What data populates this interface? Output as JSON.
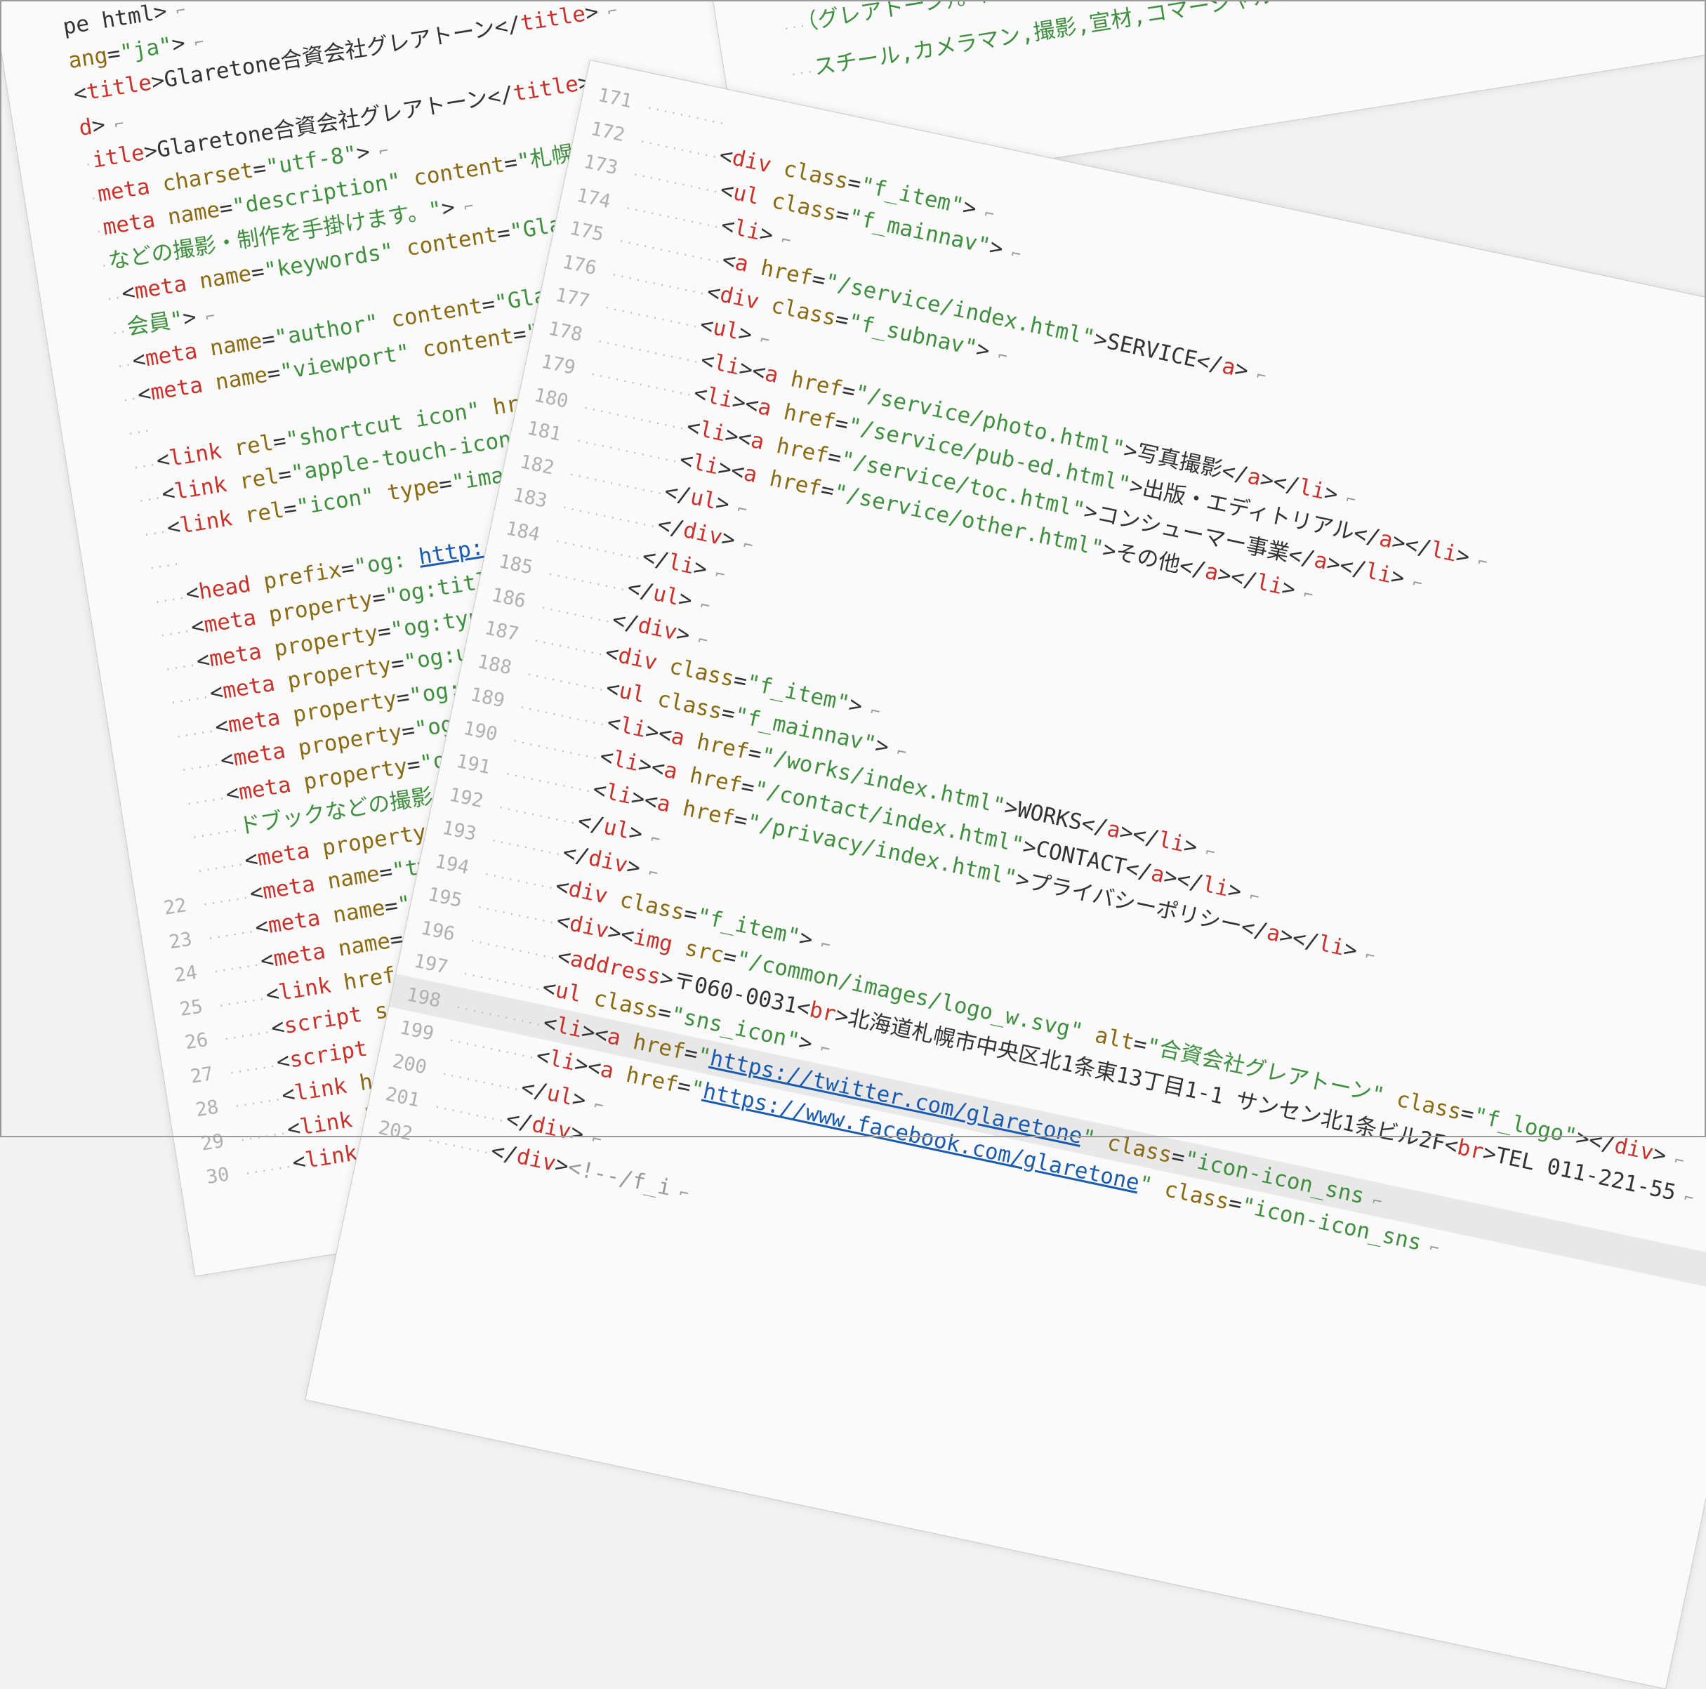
{
  "back_sheet": {
    "lines": [
      {
        "n": "",
        "html": "<span class='p'>pe html&gt;</span>"
      },
      {
        "n": "",
        "html": "<span class='a'>ang</span><span class='p'>=</span><span class='s'>\"ja\"</span><span class='p'>&gt;</span>"
      },
      {
        "n": "",
        "html": "<span class='p'>&lt;</span><span class='t'>title</span><span class='p'>&gt;Glaretone合資会社グレアトーン&lt;/</span><span class='t'>title</span><span class='p'>&gt;</span>"
      },
      {
        "n": "",
        "html": "<span class='t'>d</span><span class='p'>&gt;</span>"
      },
      {
        "n": "",
        "html": "<span class='t'>itle</span><span class='p'>&gt;Glaretone合資会社グレアトーン&lt;/</span><span class='t'>title</span><span class='p'>&gt;</span>"
      },
      {
        "n": "",
        "html": "<span class='t'>meta</span> <span class='a'>charset</span><span class='p'>=</span><span class='s'>\"utf-8\"</span><span class='p'>&gt;</span>"
      },
      {
        "n": "",
        "html": "<span class='t'>meta</span> <span class='a'>name</span><span class='p'>=</span><span class='s'>\"description\"</span> <span class='a'>content</span><span class='p'>=</span><span class='s'>\"札幌のフォトスタジオ</span>"
      },
      {
        "n": "",
        "html": "<span class='s'>などの撮影・制作を手掛けます。\"</span><span class='p'>&gt;</span>"
      },
      {
        "n": "",
        "html": "<span class='p'>&lt;</span><span class='t'>meta</span> <span class='a'>name</span><span class='p'>=</span><span class='s'>\"keywords\"</span> <span class='a'>content</span><span class='p'>=</span><span class='s'>\"Glaretone,グレアトーン</span>"
      },
      {
        "n": "",
        "html": "<span class='s'>会員\"</span><span class='p'>&gt;</span>"
      },
      {
        "n": "",
        "html": "<span class='p'>&lt;</span><span class='t'>meta</span> <span class='a'>name</span><span class='p'>=</span><span class='s'>\"author\"</span> <span class='a'>content</span><span class='p'>=</span><span class='s'>\"Glaretone\"</span><span class='p'>&gt;</span>"
      },
      {
        "n": "",
        "html": "<span class='p'>&lt;</span><span class='t'>meta</span> <span class='a'>name</span><span class='p'>=</span><span class='s'>\"viewport\"</span> <span class='a'>content</span><span class='p'>=</span><span class='s'>\"width=device-width</span>"
      },
      {
        "n": "",
        "html": ""
      },
      {
        "n": "",
        "html": "<span class='p'>&lt;</span><span class='t'>link</span> <span class='a'>rel</span><span class='p'>=</span><span class='s'>\"shortcut icon\"</span> <span class='a'>href</span><span class='p'>=</span><span class='s'>\"/favicon.ico\"</span><span class='p'>&gt;</span>"
      },
      {
        "n": "",
        "html": "<span class='p'>&lt;</span><span class='t'>link</span> <span class='a'>rel</span><span class='p'>=</span><span class='s'>\"apple-touch-icon\"</span> <span class='a'>href</span><span class='p'>=</span><span class='s'>\"/apple-tou</span>"
      },
      {
        "n": "",
        "html": "<span class='p'>&lt;</span><span class='t'>link</span> <span class='a'>rel</span><span class='p'>=</span><span class='s'>\"icon\"</span> <span class='a'>type</span><span class='p'>=</span><span class='s'>\"image/png\"</span> <span class='a'>href</span><span class='p'>=</span><span class='s'>\"/and</span>"
      },
      {
        "n": "",
        "html": ""
      },
      {
        "n": "",
        "html": "<span class='p'>&lt;</span><span class='t'>head</span> <span class='a'>prefix</span><span class='p'>=</span><span class='s'>\"og: </span><span class='u'>http://ogp.me/ns</span><span class='s'># fb: </span><span class='u'>h</span>"
      },
      {
        "n": "",
        "html": "<span class='p'>&lt;</span><span class='t'>meta</span> <span class='a'>property</span><span class='p'>=</span><span class='s'>\"og:title\"</span> <span class='a'>content</span><span class='p'>=</span><span class='s'>\"合資会</span>"
      },
      {
        "n": "",
        "html": "<span class='p'>&lt;</span><span class='t'>meta</span> <span class='a'>property</span><span class='p'>=</span><span class='s'>\"og:type\"</span> <span class='a'>content</span><span class='p'>=</span><span class='s'>\"websi</span>"
      },
      {
        "n": "",
        "html": "<span class='p'>&lt;</span><span class='t'>meta</span> <span class='a'>property</span><span class='p'>=</span><span class='s'>\"og:url\"</span> <span class='a'>content</span><span class='p'>=</span><span class='s'>\"</span><span class='u'>https</span>"
      },
      {
        "n": "",
        "html": "<span class='p'>&lt;</span><span class='t'>meta</span> <span class='a'>property</span><span class='p'>=</span><span class='s'>\"og:image\"</span> <span class='a'>content</span><span class='p'>=</span><span class='s'>\"</span><span class='u'>h</span>"
      },
      {
        "n": "",
        "html": "<span class='p'>&lt;</span><span class='t'>meta</span> <span class='a'>property</span><span class='p'>=</span><span class='s'>\"og:site_name\"</span> <span class='a'>conte</span>"
      },
      {
        "n": "",
        "html": "<span class='p'>&lt;</span><span class='t'>meta</span> <span class='a'>property</span><span class='p'>=</span><span class='s'>\"og:description\"</span> <span class='a'>co</span>"
      },
      {
        "n": "",
        "html": "<span class='s'>ドブックなどの撮影・制作を手掛け</span>"
      },
      {
        "n": "",
        "html": "<span class='p'>&lt;</span><span class='t'>meta</span> <span class='a'>property</span><span class='p'>=</span><span class='s'>\"og:locale\"</span> <span class='a'>conte</span>"
      },
      {
        "n": "22",
        "html": "<span class='p'>&lt;</span><span class='t'>meta</span> <span class='a'>name</span><span class='p'>=</span><span class='s'>\"twitter:card\"</span> <span class='a'>conte</span>"
      },
      {
        "n": "23",
        "html": "<span class='p'>&lt;</span><span class='t'>meta</span> <span class='a'>name</span><span class='p'>=</span><span class='s'>\"twitter:site\"</span> <span class='a'>con</span>"
      },
      {
        "n": "24",
        "html": "<span class='p'>&lt;</span><span class='t'>meta</span> <span class='a'>name</span><span class='p'>=</span><span class='s'>\"twitter:creator\"</span>"
      },
      {
        "n": "25",
        "html": "<span class='p'>&lt;</span><span class='t'>link</span> <span class='a'>href</span><span class='p'>=</span><span class='s'>\"/common/css/pac</span>"
      },
      {
        "n": "26",
        "html": "<span class='p'>&lt;</span><span class='t'>script</span> <span class='a'>src</span><span class='p'>=</span><span class='s'>\"/common/js/jq</span>"
      },
      {
        "n": "27",
        "html": "<span class='p'>&lt;</span><span class='t'>script</span> <span class='a'>src</span><span class='p'>=</span><span class='s'>\"/common/js/p</span>"
      },
      {
        "n": "28",
        "html": "<span class='p'>&lt;</span><span class='t'>link</span> <span class='a'>href</span><span class='p'>=</span><span class='s'>\"/common/css</span>"
      },
      {
        "n": "29",
        "html": "<span class='p'>&lt;</span><span class='t'>link</span> <span class='a'>href</span><span class='p'>=</span><span class='s'>\"/common/cs</span>"
      },
      {
        "n": "30",
        "html": "<span class='p'>&lt;</span><span class='t'>link</span> <span class='a'>href</span><span class='p'>=</span><span class='s'>\"/common/c</span>"
      }
    ]
  },
  "top_sheet": {
    "lines": [
      {
        "n": "",
        "html": "<span class='s'>（グレアトーン）。料理、スポーツ、人物(モデル)、キッチンスタジオ</span>"
      },
      {
        "n": "",
        "html": "<span class='s'>スチール,カメラマン,撮影,宣材,コマーシャルフォト,キッチンスタジオ</span>"
      }
    ]
  },
  "front_sheet": {
    "lines": [
      {
        "n": "171",
        "html": ""
      },
      {
        "n": "172",
        "html": "<span class='p'>&lt;</span><span class='t'>div</span> <span class='a'>class</span><span class='p'>=</span><span class='s'>\"f_item\"</span><span class='p'>&gt;</span>"
      },
      {
        "n": "173",
        "html": "<span class='p'>&lt;</span><span class='t'>ul</span> <span class='a'>class</span><span class='p'>=</span><span class='s'>\"f_mainnav\"</span><span class='p'>&gt;</span>"
      },
      {
        "n": "174",
        "html": "<span class='p'>&lt;</span><span class='t'>li</span><span class='p'>&gt;</span>"
      },
      {
        "n": "175",
        "html": "<span class='p'>&lt;</span><span class='t'>a</span> <span class='a'>href</span><span class='p'>=</span><span class='s'>\"/service/index.html\"</span><span class='p'>&gt;SERVICE&lt;/</span><span class='t'>a</span><span class='p'>&gt;</span>"
      },
      {
        "n": "176",
        "html": "<span class='p'>&lt;</span><span class='t'>div</span> <span class='a'>class</span><span class='p'>=</span><span class='s'>\"f_subnav\"</span><span class='p'>&gt;</span>"
      },
      {
        "n": "177",
        "html": "<span class='p'>&lt;</span><span class='t'>ul</span><span class='p'>&gt;</span>"
      },
      {
        "n": "178",
        "html": "<span class='p'>&lt;</span><span class='t'>li</span><span class='p'>&gt;&lt;</span><span class='t'>a</span> <span class='a'>href</span><span class='p'>=</span><span class='s'>\"/service/photo.html\"</span><span class='p'>&gt;写真撮影&lt;/</span><span class='t'>a</span><span class='p'>&gt;&lt;/</span><span class='t'>li</span><span class='p'>&gt;</span>"
      },
      {
        "n": "179",
        "html": "<span class='p'>&lt;</span><span class='t'>li</span><span class='p'>&gt;&lt;</span><span class='t'>a</span> <span class='a'>href</span><span class='p'>=</span><span class='s'>\"/service/pub-ed.html\"</span><span class='p'>&gt;出版・エディトリアル&lt;/</span><span class='t'>a</span><span class='p'>&gt;&lt;/</span><span class='t'>li</span><span class='p'>&gt;</span>"
      },
      {
        "n": "180",
        "html": "<span class='p'>&lt;</span><span class='t'>li</span><span class='p'>&gt;&lt;</span><span class='t'>a</span> <span class='a'>href</span><span class='p'>=</span><span class='s'>\"/service/toc.html\"</span><span class='p'>&gt;コンシューマー事業&lt;/</span><span class='t'>a</span><span class='p'>&gt;&lt;/</span><span class='t'>li</span><span class='p'>&gt;</span>"
      },
      {
        "n": "181",
        "html": "<span class='p'>&lt;</span><span class='t'>li</span><span class='p'>&gt;&lt;</span><span class='t'>a</span> <span class='a'>href</span><span class='p'>=</span><span class='s'>\"/service/other.html\"</span><span class='p'>&gt;その他&lt;/</span><span class='t'>a</span><span class='p'>&gt;&lt;/</span><span class='t'>li</span><span class='p'>&gt;</span>"
      },
      {
        "n": "182",
        "html": "<span class='p'>&lt;/</span><span class='t'>ul</span><span class='p'>&gt;</span>"
      },
      {
        "n": "183",
        "html": "<span class='p'>&lt;/</span><span class='t'>div</span><span class='p'>&gt;</span>"
      },
      {
        "n": "184",
        "html": "<span class='p'>&lt;/</span><span class='t'>li</span><span class='p'>&gt;</span>"
      },
      {
        "n": "185",
        "html": "<span class='p'>&lt;/</span><span class='t'>ul</span><span class='p'>&gt;</span>"
      },
      {
        "n": "186",
        "html": "<span class='p'>&lt;/</span><span class='t'>div</span><span class='p'>&gt;</span>"
      },
      {
        "n": "187",
        "html": "<span class='p'>&lt;</span><span class='t'>div</span> <span class='a'>class</span><span class='p'>=</span><span class='s'>\"f_item\"</span><span class='p'>&gt;</span>"
      },
      {
        "n": "188",
        "html": "<span class='p'>&lt;</span><span class='t'>ul</span> <span class='a'>class</span><span class='p'>=</span><span class='s'>\"f_mainnav\"</span><span class='p'>&gt;</span>"
      },
      {
        "n": "189",
        "html": "<span class='p'>&lt;</span><span class='t'>li</span><span class='p'>&gt;&lt;</span><span class='t'>a</span> <span class='a'>href</span><span class='p'>=</span><span class='s'>\"/works/index.html\"</span><span class='p'>&gt;WORKS&lt;/</span><span class='t'>a</span><span class='p'>&gt;&lt;/</span><span class='t'>li</span><span class='p'>&gt;</span>"
      },
      {
        "n": "190",
        "html": "<span class='p'>&lt;</span><span class='t'>li</span><span class='p'>&gt;&lt;</span><span class='t'>a</span> <span class='a'>href</span><span class='p'>=</span><span class='s'>\"/contact/index.html\"</span><span class='p'>&gt;CONTACT&lt;/</span><span class='t'>a</span><span class='p'>&gt;&lt;/</span><span class='t'>li</span><span class='p'>&gt;</span>"
      },
      {
        "n": "191",
        "html": "<span class='p'>&lt;</span><span class='t'>li</span><span class='p'>&gt;&lt;</span><span class='t'>a</span> <span class='a'>href</span><span class='p'>=</span><span class='s'>\"/privacy/index.html\"</span><span class='p'>&gt;プライバシーポリシー&lt;/</span><span class='t'>a</span><span class='p'>&gt;&lt;/</span><span class='t'>li</span><span class='p'>&gt;</span>"
      },
      {
        "n": "192",
        "html": "<span class='p'>&lt;/</span><span class='t'>ul</span><span class='p'>&gt;</span>"
      },
      {
        "n": "193",
        "html": "<span class='p'>&lt;/</span><span class='t'>div</span><span class='p'>&gt;</span>"
      },
      {
        "n": "194",
        "html": "<span class='p'>&lt;</span><span class='t'>div</span> <span class='a'>class</span><span class='p'>=</span><span class='s'>\"f_item\"</span><span class='p'>&gt;</span>"
      },
      {
        "n": "195",
        "html": "<span class='p'>&lt;</span><span class='t'>div</span><span class='p'>&gt;&lt;</span><span class='t'>img</span> <span class='a'>src</span><span class='p'>=</span><span class='s'>\"/common/images/logo_w.svg\"</span> <span class='a'>alt</span><span class='p'>=</span><span class='s'>\"合資会社グレアトーン\"</span> <span class='a'>class</span><span class='p'>=</span><span class='s'>\"f_logo\"</span><span class='p'>&gt;&lt;/</span><span class='t'>div</span><span class='p'>&gt;</span>"
      },
      {
        "n": "196",
        "html": "<span class='p'>&lt;</span><span class='t'>address</span><span class='p'>&gt;〒060-0031&lt;</span><span class='t'>br</span><span class='p'>&gt;北海道札幌市中央区北1条東13丁目1-1 サンセン北1条ビル2F&lt;</span><span class='t'>br</span><span class='p'>&gt;TEL 011-221-55</span>"
      },
      {
        "n": "197",
        "html": "<span class='p'>&lt;</span><span class='t'>ul</span> <span class='a'>class</span><span class='p'>=</span><span class='s'>\"sns_icon\"</span><span class='p'>&gt;</span>"
      },
      {
        "n": "198",
        "html": "<span class='p'>&lt;</span><span class='t'>li</span><span class='p'>&gt;&lt;</span><span class='t'>a</span> <span class='a'>href</span><span class='p'>=</span><span class='s'>\"</span><span class='u'>https://twitter.com/glaretone</span><span class='s'>\"</span> <span class='a'>class</span><span class='p'>=</span><span class='s'>\"icon-icon_sns</span>"
      },
      {
        "n": "199",
        "html": "<span class='p'>&lt;</span><span class='t'>li</span><span class='p'>&gt;&lt;</span><span class='t'>a</span> <span class='a'>href</span><span class='p'>=</span><span class='s'>\"</span><span class='u'>https://www.facebook.com/glaretone</span><span class='s'>\"</span> <span class='a'>class</span><span class='p'>=</span><span class='s'>\"icon-icon_sns</span>"
      },
      {
        "n": "200",
        "html": "<span class='p'>&lt;/</span><span class='t'>ul</span><span class='p'>&gt;</span>"
      },
      {
        "n": "201",
        "html": "<span class='p'>&lt;/</span><span class='t'>div</span><span class='p'>&gt;</span>"
      },
      {
        "n": "202",
        "html": "<span class='p'>&lt;/</span><span class='t'>div</span><span class='p'>&gt;</span><span class='c'>&lt;!--/f_i</span>"
      }
    ],
    "highlight_line": "198"
  },
  "colors": {
    "tag": "#c8322b",
    "attribute": "#8a6a12",
    "string": "#3f8f3f",
    "link": "#1a5bb0",
    "background": "#fafafa"
  }
}
